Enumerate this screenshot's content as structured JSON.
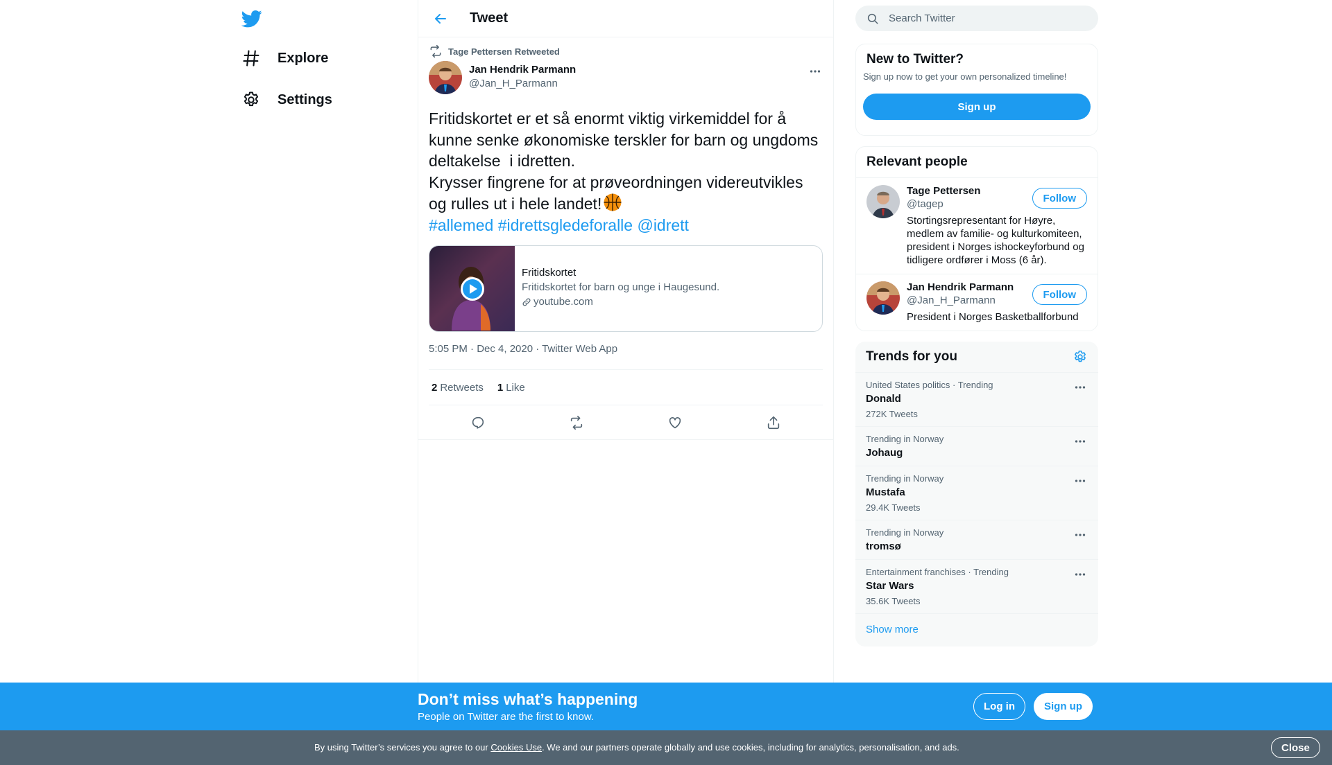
{
  "colors": {
    "accent": "#1d9bf0",
    "text": "#0f1419",
    "muted": "#536471",
    "border": "#eff3f4",
    "cookie_bg": "#536471"
  },
  "nav": {
    "logo_icon": "twitter-bird-icon",
    "items": [
      {
        "label": "Explore",
        "icon": "hashtag-icon"
      },
      {
        "label": "Settings",
        "icon": "gear-icon"
      }
    ]
  },
  "header": {
    "title": "Tweet",
    "back_icon": "arrow-left-icon"
  },
  "tweet": {
    "retweeted_by": "Tage Pettersen Retweeted",
    "author_name": "Jan Hendrik Parmann",
    "author_handle": "@Jan_H_Parmann",
    "text": "Fritidskortet er et så enormt viktig virkemiddel for å kunne senke økonomiske terskler for barn og ungdoms deltakelse  i idretten.\nKrysser fingrene for at prøveordningen videreutvikles og rulles ut i hele landet!",
    "emoji_icon": "basketball-emoji",
    "tags": [
      "#allemed",
      "#idrettsgledeforalle",
      "@idrett"
    ],
    "card": {
      "title": "Fritidskortet",
      "description": "Fritidskortet for barn og unge i Haugesund.",
      "link": "youtube.com"
    },
    "meta": "5:05 PM · Dec 4, 2020 · Twitter Web App",
    "retweets_count": "2",
    "retweets_label": "Retweets",
    "likes_count": "1",
    "likes_label": "Like"
  },
  "search": {
    "placeholder": "Search Twitter"
  },
  "new_to_twitter": {
    "title": "New to Twitter?",
    "subtitle": "Sign up now to get your own personalized timeline!",
    "button": "Sign up"
  },
  "relevant": {
    "title": "Relevant people",
    "people": [
      {
        "name": "Tage Pettersen",
        "handle": "@tagep",
        "bio": "Stortingsrepresentant for Høyre, medlem av familie- og kulturkomiteen, president i Norges ishockeyforbund og tidligere ordfører i Moss (6 år).",
        "button": "Follow"
      },
      {
        "name": "Jan Hendrik Parmann",
        "handle": "@Jan_H_Parmann",
        "bio": "President i Norges Basketballforbund",
        "button": "Follow"
      }
    ]
  },
  "trends": {
    "title": "Trends for you",
    "items": [
      {
        "context": "United States politics · Trending",
        "name": "Donald",
        "count": "272K Tweets"
      },
      {
        "context": "Trending in Norway",
        "name": "Johaug",
        "count": ""
      },
      {
        "context": "Trending in Norway",
        "name": "Mustafa",
        "count": "29.4K Tweets"
      },
      {
        "context": "Trending in Norway",
        "name": "tromsø",
        "count": ""
      },
      {
        "context": "Entertainment franchises · Trending",
        "name": "Star Wars",
        "count": "35.6K Tweets"
      }
    ],
    "show_more": "Show more"
  },
  "bottom_bar": {
    "title": "Don’t miss what’s happening",
    "subtitle": "People on Twitter are the first to know.",
    "login": "Log in",
    "signup": "Sign up"
  },
  "cookie": {
    "prefix": "By using Twitter’s services you agree to our ",
    "link": "Cookies Use",
    "suffix": ". We and our partners operate globally and use cookies, including for analytics, personalisation, and ads.",
    "close": "Close"
  }
}
